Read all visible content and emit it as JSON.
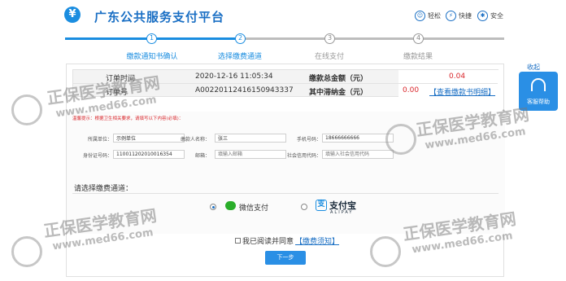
{
  "header": {
    "title": "广东公共服务支付平台",
    "logo_symbol": "¥",
    "links": [
      {
        "label": "轻松",
        "icon": "smile-icon",
        "glyph": "☺"
      },
      {
        "label": "快捷",
        "icon": "bolt-icon",
        "glyph": "⚡"
      },
      {
        "label": "安全",
        "icon": "shield-icon",
        "glyph": "✱"
      }
    ]
  },
  "steps": [
    {
      "num": "1",
      "label": "缴款通知书确认",
      "state": "done"
    },
    {
      "num": "2",
      "label": "选择缴费通道",
      "state": "current"
    },
    {
      "num": "3",
      "label": "在线支付",
      "state": "todo"
    },
    {
      "num": "4",
      "label": "缴款结果",
      "state": "todo"
    }
  ],
  "help": {
    "collapse_label": "收起",
    "label": "客服帮助"
  },
  "order": {
    "time_label": "订单时间",
    "time_value": "2020-12-16 11:05:34",
    "no_label": "订单号",
    "no_value": "A00220112416150943337",
    "total_label": "缴款总金额（元）",
    "total_value": "0.04",
    "late_label": "其中滞纳金（元）",
    "late_value": "0.00",
    "detail_link": "【查看缴款书明细】"
  },
  "form": {
    "tip": "温馨提示：根据卫生相关要求，请填写以下内容(必填)：",
    "unit_label": "所属单位：",
    "unit_value": "示例单位",
    "payer_label": "缴款人名称：",
    "payer_value": "张三",
    "phone_label": "手机号码：",
    "phone_value": "18666666666",
    "id_label": "身份证号码：",
    "id_value": "110011202010016354",
    "email_label": "邮箱：",
    "email_placeholder": "填输入邮箱",
    "credit_label": "社会信用代码：",
    "credit_placeholder": "填输入社会信用代码"
  },
  "payment": {
    "section_title": "请选择缴费通道：",
    "wechat_label": "微信支付",
    "alipay_label": "支付宝",
    "alipay_sub": "ALIPAY",
    "alipay_glyph": "支",
    "selected": "wechat"
  },
  "agree": {
    "text": "我已阅读并同意",
    "link": "【缴费须知】"
  },
  "next_button": "下一步",
  "watermark": {
    "title": "正保医学教育网",
    "url": "www.med66.com"
  },
  "colors": {
    "primary": "#1a8de0",
    "accent_red": "#d9262b",
    "link": "#1a6fc4"
  }
}
